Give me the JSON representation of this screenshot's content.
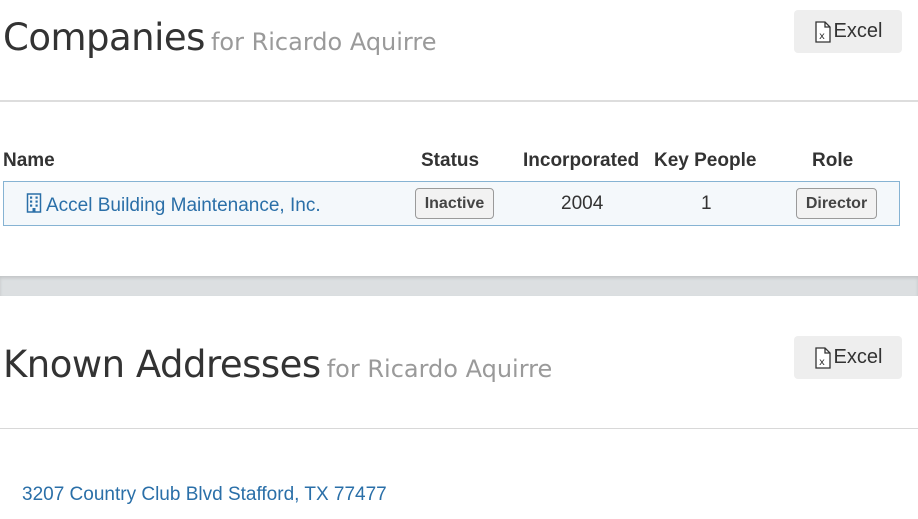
{
  "companies": {
    "title": "Companies",
    "subtitle": "for Ricardo Aquirre",
    "excel_label": "Excel",
    "columns": [
      "Name",
      "Status",
      "Incorporated",
      "Key People",
      "Role"
    ],
    "rows": [
      {
        "name": "Accel Building Maintenance, Inc.",
        "status": "Inactive",
        "incorporated": "2004",
        "key_people": "1",
        "role": "Director"
      }
    ]
  },
  "addresses": {
    "title": "Known Addresses",
    "subtitle": "for Ricardo Aquirre",
    "excel_label": "Excel",
    "items": [
      "3207 Country Club Blvd Stafford, TX 77477"
    ]
  },
  "colors": {
    "link": "#2a6fa8",
    "row_border": "#86b3d3",
    "button_bg": "#eeeeee"
  },
  "icons": {
    "excel": "excel-file-icon",
    "company": "building-icon"
  }
}
